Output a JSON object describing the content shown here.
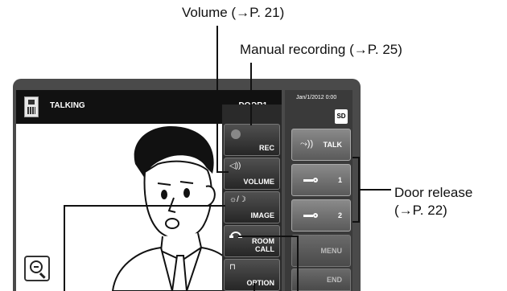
{
  "callouts": {
    "volume": "Volume (→P. 21)",
    "manual_recording": "Manual recording (→P. 25)",
    "door_release_line1": "Door release",
    "door_release_line2": "(→P. 22)"
  },
  "screen": {
    "status": "TALKING",
    "door": "DOOR1"
  },
  "side": {
    "datetime": "Jan/1/2012 0:00",
    "sd_label": "SD"
  },
  "menu_buttons": {
    "rec": "REC",
    "volume": "VOLUME",
    "image": "IMAGE",
    "room_call_1": "ROOM",
    "room_call_2": "CALL",
    "option": "OPTION"
  },
  "side_buttons": {
    "talk": "TALK",
    "door1": "1",
    "door2": "2",
    "menu": "MENU",
    "end": "END"
  },
  "icons": {
    "volume": "◁))",
    "image": "☼/☽",
    "talk": "⤳))",
    "option": "⊓"
  },
  "colors": {
    "device_body": "#4a4a4a",
    "top_bar": "#111111",
    "button_dark": "#262626",
    "button_light": "#8a8a8a"
  }
}
